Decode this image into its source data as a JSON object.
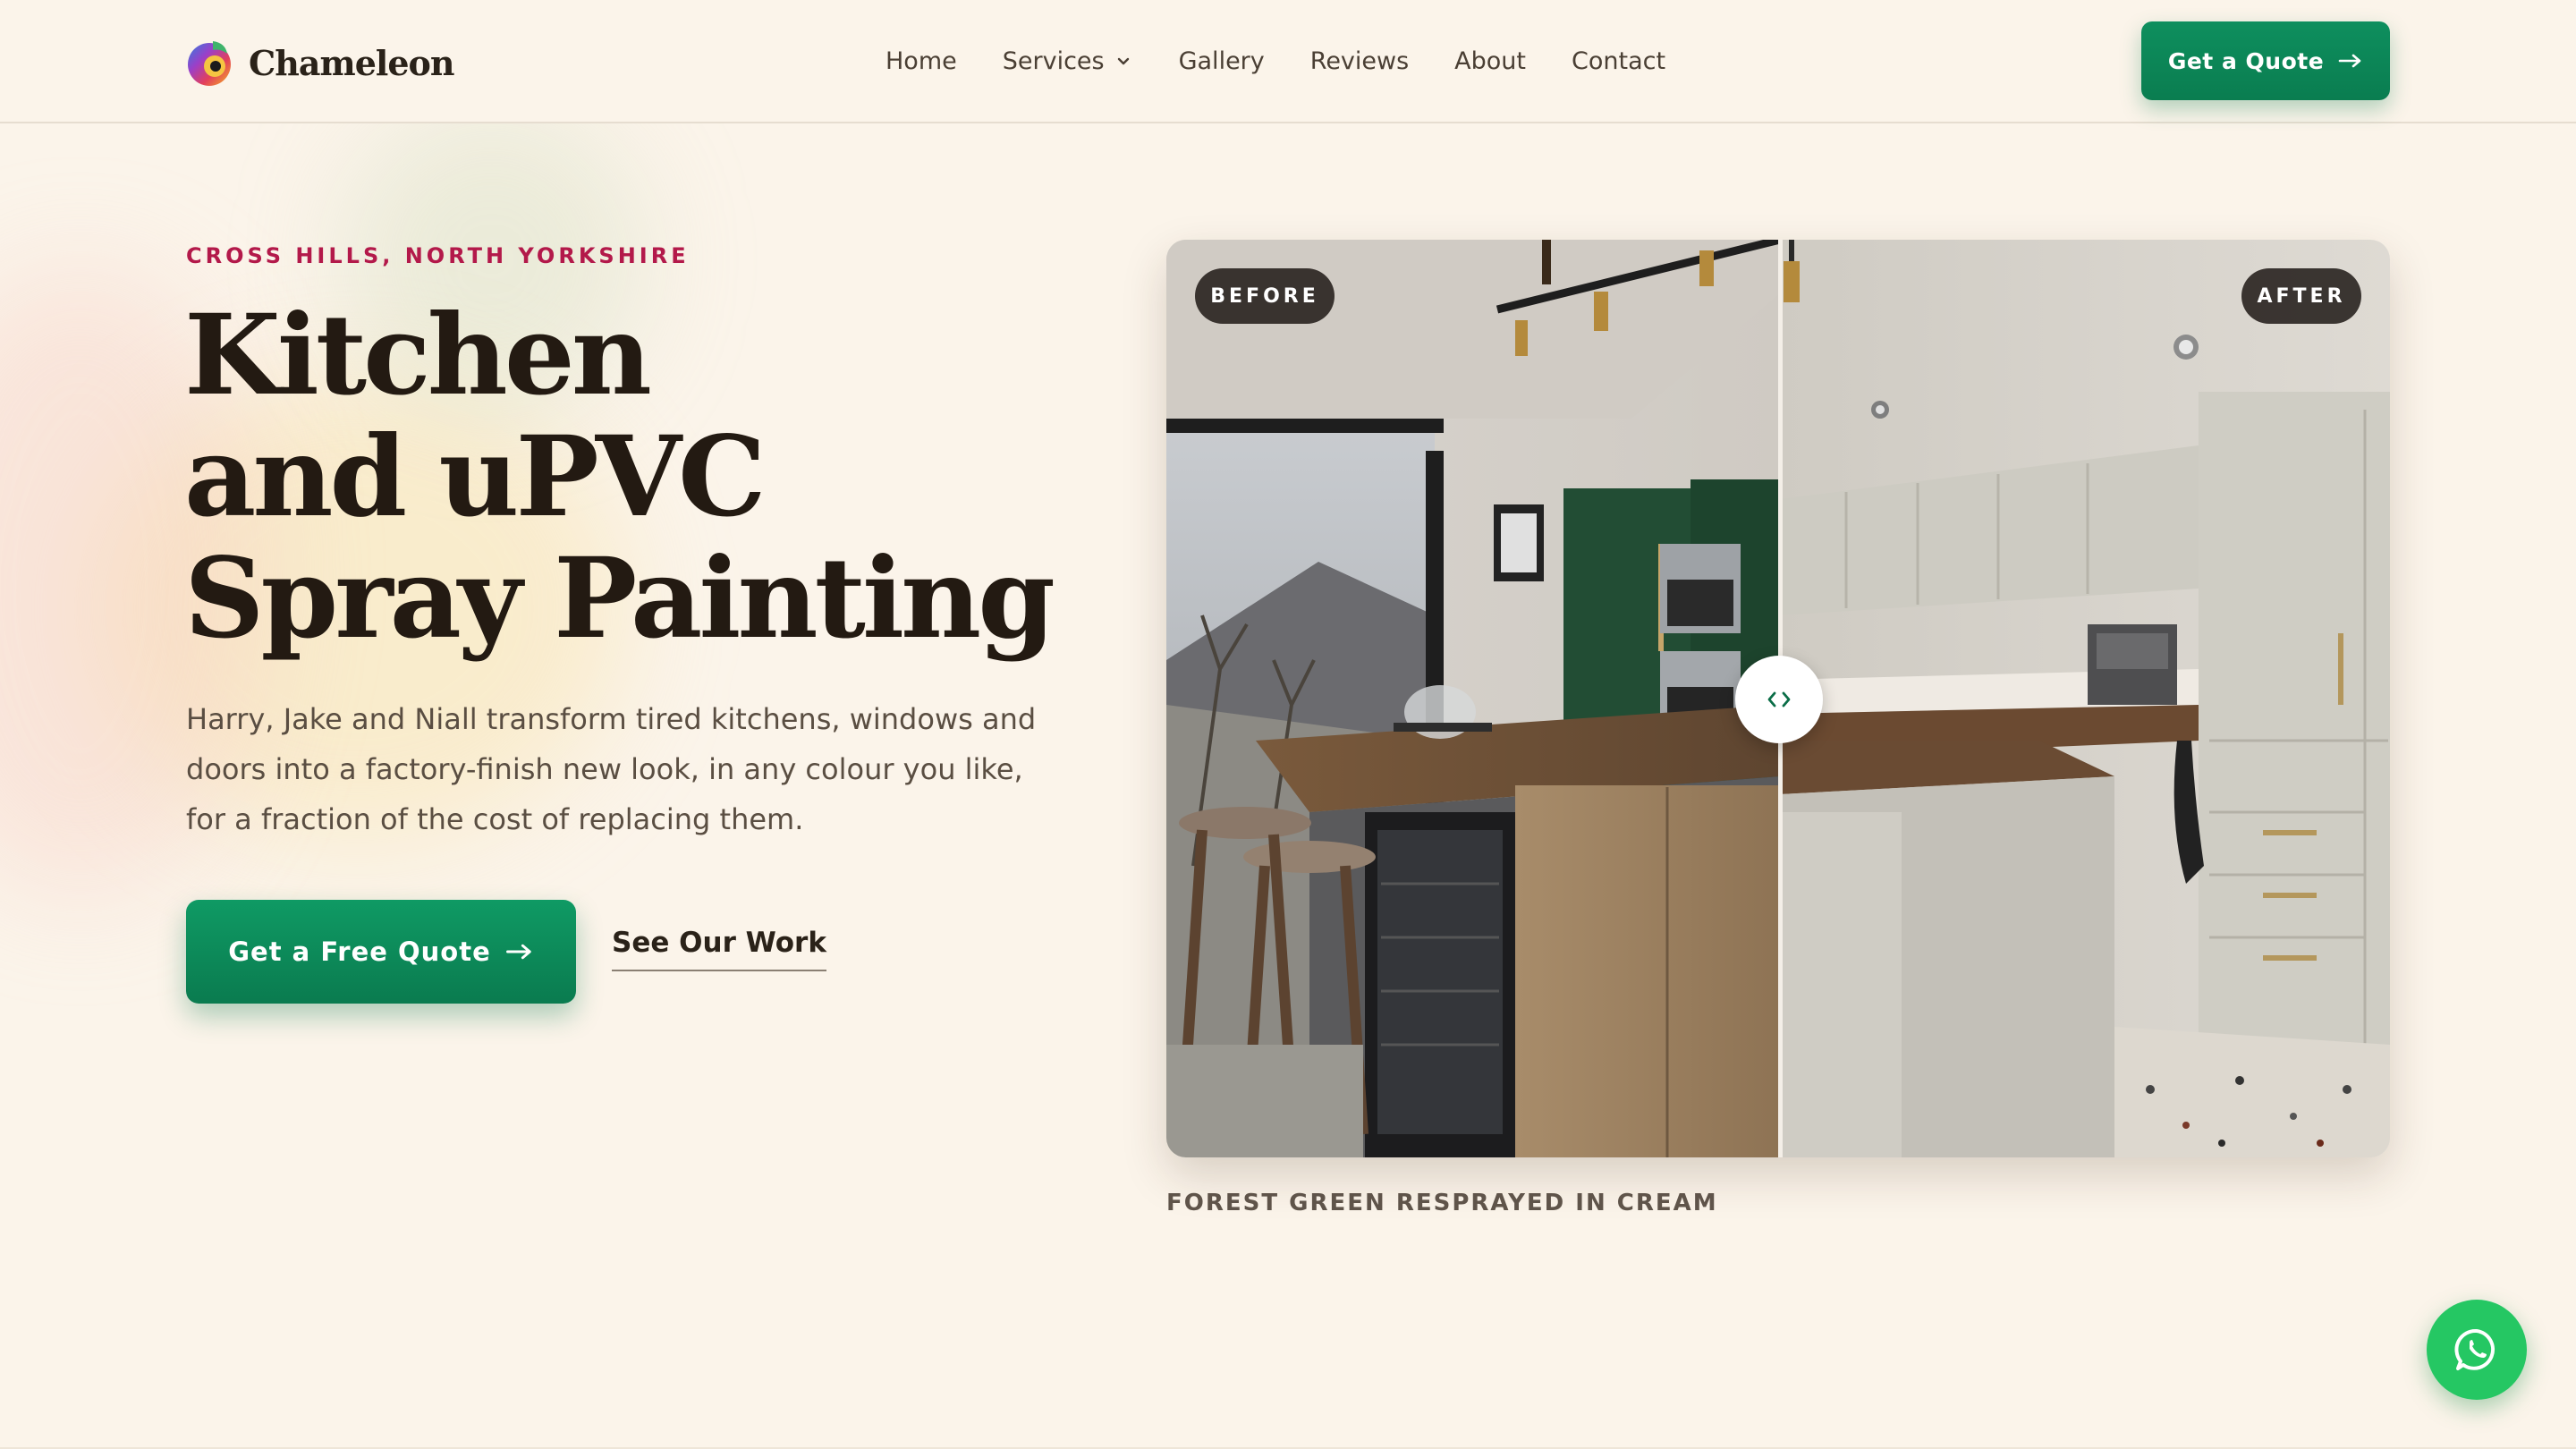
{
  "brand": {
    "name": "Chameleon"
  },
  "nav": {
    "items": [
      {
        "label": "Home"
      },
      {
        "label": "Services",
        "has_dropdown": true
      },
      {
        "label": "Gallery"
      },
      {
        "label": "Reviews"
      },
      {
        "label": "About"
      },
      {
        "label": "Contact"
      }
    ],
    "cta_label": "Get a Quote"
  },
  "hero": {
    "eyebrow": "CROSS HILLS, NORTH YORKSHIRE",
    "headline": [
      "Kitchen",
      "and uPVC",
      "Spray Painting"
    ],
    "lede": "Harry, Jake and Niall transform tired kitchens, windows and doors into a factory-finish new look, in any colour you like, for a fraction of the cost of replacing them.",
    "primary_cta": "Get a Free Quote",
    "secondary_cta": "See Our Work"
  },
  "comparison": {
    "before_label": "BEFORE",
    "after_label": "AFTER",
    "caption": "FOREST GREEN RESPRAYED IN CREAM",
    "slider_position": 0.5
  },
  "colors": {
    "background": "#fbf4ea",
    "accent_green": "#0a7d50",
    "eyebrow_red": "#b3194a",
    "whatsapp_green": "#25c763"
  },
  "icons": {
    "arrow": "arrow-right-icon",
    "dropdown": "chevron-down-icon",
    "slider_handle": "code-arrows-icon",
    "chat": "whatsapp-icon"
  }
}
